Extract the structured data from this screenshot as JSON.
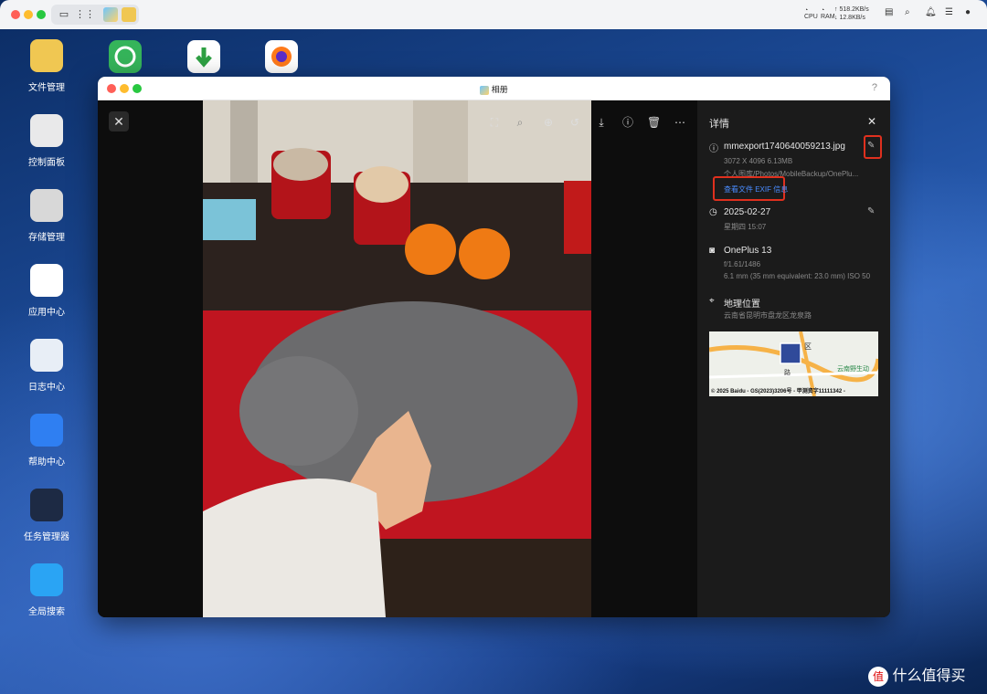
{
  "topbar": {
    "net_up": "↑ 518.2KB/s",
    "net_down": "↓ 12.8KB/s",
    "cpu_label": "CPU",
    "ram_label": "RAM"
  },
  "desktop": {
    "icons": [
      {
        "label": "文件管理",
        "color": "#f0c752"
      },
      {
        "label": "控制面板",
        "color": "#e9e9ea"
      },
      {
        "label": "存储管理",
        "color": "#d8d8d8"
      },
      {
        "label": "应用中心",
        "color": "#ffffff"
      },
      {
        "label": "日志中心",
        "color": "#e8eef6"
      },
      {
        "label": "帮助中心",
        "color": "#2f7ff2"
      },
      {
        "label": "任务管理器",
        "color": "#1d2a44"
      },
      {
        "label": "全局搜索",
        "color": "#2aa4f4"
      }
    ],
    "top_icons": [
      {
        "name": "sync",
        "color": "#35b45a"
      },
      {
        "name": "download",
        "color": "#ffffff"
      },
      {
        "name": "firefox",
        "color": "#ffffff"
      }
    ]
  },
  "window": {
    "title": "相册",
    "help": "?"
  },
  "details": {
    "heading": "详情",
    "file": {
      "name": "mmexport1740640059213.jpg",
      "dims": "3072 X 4096  6.13MB",
      "path": "个人图库/Photos/MobileBackup/OnePlu...",
      "exif_link": "查看文件 EXIF 信息"
    },
    "date": {
      "value": "2025-02-27",
      "time": "星期四 15:07"
    },
    "camera": {
      "model": "OnePlus 13",
      "aperture": "f/1.61/1486",
      "lens": "6.1 mm (35 mm equivalent: 23.0 mm) ISO 50"
    },
    "location": {
      "title": "地理位置",
      "address": "云南省昆明市盘龙区龙泉路"
    },
    "map": {
      "labels": [
        "区",
        "云南野生动",
        "路"
      ],
      "credit": "© 2025 Baidu - GS(2023)3206号 - 甲测资字11111342 -"
    }
  },
  "watermark": "什么值得买"
}
